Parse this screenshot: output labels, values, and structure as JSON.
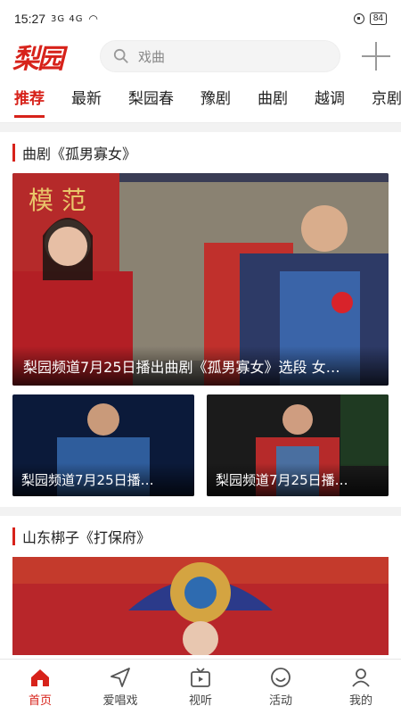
{
  "status": {
    "time": "15:27",
    "signal": "3G 4G",
    "battery": "84"
  },
  "header": {
    "logo": "梨园",
    "search_placeholder": "戏曲"
  },
  "tabs": [
    "推荐",
    "最新",
    "梨园春",
    "豫剧",
    "曲剧",
    "越调",
    "京剧"
  ],
  "sections": [
    {
      "title": "曲剧《孤男寡女》",
      "main_caption": "梨园频道7月25日播出曲剧《孤男寡女》选段 女…",
      "thumbs": [
        "梨园频道7月25日播…",
        "梨园频道7月25日播…"
      ]
    },
    {
      "title": "山东梆子《打保府》"
    }
  ],
  "nav": [
    {
      "label": "首页",
      "icon": "home-icon"
    },
    {
      "label": "爱唱戏",
      "icon": "send-icon"
    },
    {
      "label": "视听",
      "icon": "tv-icon"
    },
    {
      "label": "活动",
      "icon": "activity-icon"
    },
    {
      "label": "我的",
      "icon": "user-icon"
    }
  ],
  "colors": {
    "accent": "#d7221a"
  }
}
